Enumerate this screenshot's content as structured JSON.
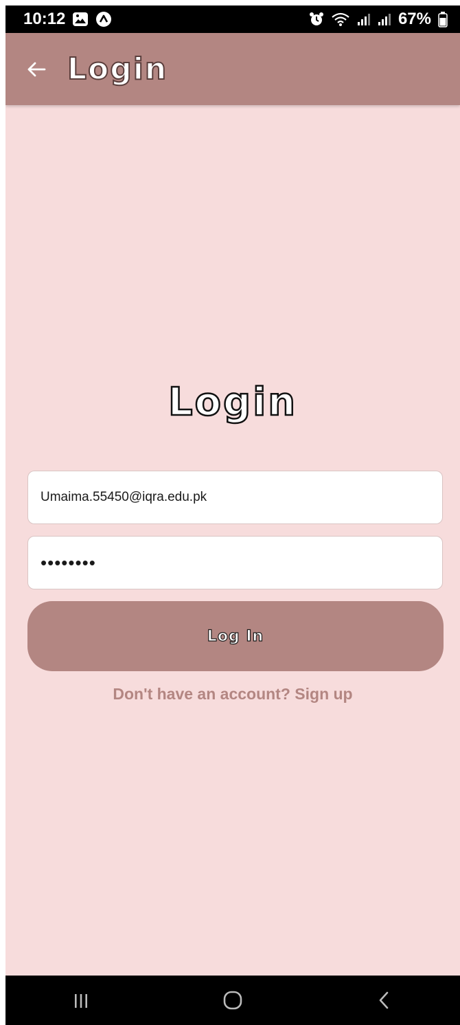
{
  "status_bar": {
    "time": "10:12",
    "battery": "67%",
    "icons": [
      "gallery-icon",
      "app-icon",
      "alarm-icon",
      "wifi-icon",
      "signal-icon",
      "signal-icon",
      "battery-icon"
    ]
  },
  "app_bar": {
    "title": "Login",
    "back_icon": "arrow-left-icon",
    "background": "#b38682"
  },
  "main": {
    "heading": "Login",
    "email_value": "Umaima.55450@iqra.edu.pk",
    "password_value": "••••••••",
    "login_button_label": "Log In",
    "signup_text": "Don't have an account? Sign up"
  },
  "colors": {
    "page_background": "#f7dcdc",
    "accent": "#b38682"
  },
  "nav_bar": {
    "buttons": [
      "recents-icon",
      "home-icon",
      "back-icon"
    ]
  }
}
